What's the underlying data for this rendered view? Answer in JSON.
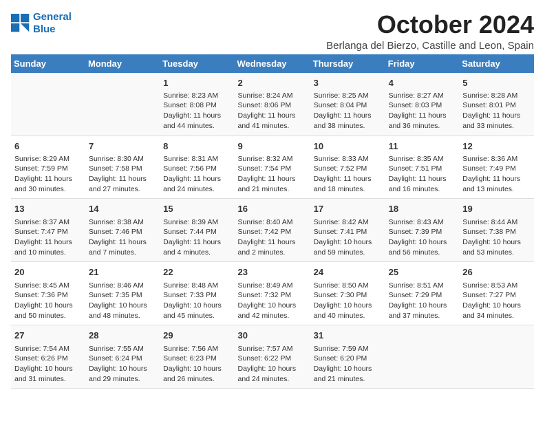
{
  "logo": {
    "line1": "General",
    "line2": "Blue"
  },
  "title": "October 2024",
  "location": "Berlanga del Bierzo, Castille and Leon, Spain",
  "weekdays": [
    "Sunday",
    "Monday",
    "Tuesday",
    "Wednesday",
    "Thursday",
    "Friday",
    "Saturday"
  ],
  "weeks": [
    [
      {
        "day": "",
        "info": ""
      },
      {
        "day": "",
        "info": ""
      },
      {
        "day": "1",
        "info": "Sunrise: 8:23 AM\nSunset: 8:08 PM\nDaylight: 11 hours and 44 minutes."
      },
      {
        "day": "2",
        "info": "Sunrise: 8:24 AM\nSunset: 8:06 PM\nDaylight: 11 hours and 41 minutes."
      },
      {
        "day": "3",
        "info": "Sunrise: 8:25 AM\nSunset: 8:04 PM\nDaylight: 11 hours and 38 minutes."
      },
      {
        "day": "4",
        "info": "Sunrise: 8:27 AM\nSunset: 8:03 PM\nDaylight: 11 hours and 36 minutes."
      },
      {
        "day": "5",
        "info": "Sunrise: 8:28 AM\nSunset: 8:01 PM\nDaylight: 11 hours and 33 minutes."
      }
    ],
    [
      {
        "day": "6",
        "info": "Sunrise: 8:29 AM\nSunset: 7:59 PM\nDaylight: 11 hours and 30 minutes."
      },
      {
        "day": "7",
        "info": "Sunrise: 8:30 AM\nSunset: 7:58 PM\nDaylight: 11 hours and 27 minutes."
      },
      {
        "day": "8",
        "info": "Sunrise: 8:31 AM\nSunset: 7:56 PM\nDaylight: 11 hours and 24 minutes."
      },
      {
        "day": "9",
        "info": "Sunrise: 8:32 AM\nSunset: 7:54 PM\nDaylight: 11 hours and 21 minutes."
      },
      {
        "day": "10",
        "info": "Sunrise: 8:33 AM\nSunset: 7:52 PM\nDaylight: 11 hours and 18 minutes."
      },
      {
        "day": "11",
        "info": "Sunrise: 8:35 AM\nSunset: 7:51 PM\nDaylight: 11 hours and 16 minutes."
      },
      {
        "day": "12",
        "info": "Sunrise: 8:36 AM\nSunset: 7:49 PM\nDaylight: 11 hours and 13 minutes."
      }
    ],
    [
      {
        "day": "13",
        "info": "Sunrise: 8:37 AM\nSunset: 7:47 PM\nDaylight: 11 hours and 10 minutes."
      },
      {
        "day": "14",
        "info": "Sunrise: 8:38 AM\nSunset: 7:46 PM\nDaylight: 11 hours and 7 minutes."
      },
      {
        "day": "15",
        "info": "Sunrise: 8:39 AM\nSunset: 7:44 PM\nDaylight: 11 hours and 4 minutes."
      },
      {
        "day": "16",
        "info": "Sunrise: 8:40 AM\nSunset: 7:42 PM\nDaylight: 11 hours and 2 minutes."
      },
      {
        "day": "17",
        "info": "Sunrise: 8:42 AM\nSunset: 7:41 PM\nDaylight: 10 hours and 59 minutes."
      },
      {
        "day": "18",
        "info": "Sunrise: 8:43 AM\nSunset: 7:39 PM\nDaylight: 10 hours and 56 minutes."
      },
      {
        "day": "19",
        "info": "Sunrise: 8:44 AM\nSunset: 7:38 PM\nDaylight: 10 hours and 53 minutes."
      }
    ],
    [
      {
        "day": "20",
        "info": "Sunrise: 8:45 AM\nSunset: 7:36 PM\nDaylight: 10 hours and 50 minutes."
      },
      {
        "day": "21",
        "info": "Sunrise: 8:46 AM\nSunset: 7:35 PM\nDaylight: 10 hours and 48 minutes."
      },
      {
        "day": "22",
        "info": "Sunrise: 8:48 AM\nSunset: 7:33 PM\nDaylight: 10 hours and 45 minutes."
      },
      {
        "day": "23",
        "info": "Sunrise: 8:49 AM\nSunset: 7:32 PM\nDaylight: 10 hours and 42 minutes."
      },
      {
        "day": "24",
        "info": "Sunrise: 8:50 AM\nSunset: 7:30 PM\nDaylight: 10 hours and 40 minutes."
      },
      {
        "day": "25",
        "info": "Sunrise: 8:51 AM\nSunset: 7:29 PM\nDaylight: 10 hours and 37 minutes."
      },
      {
        "day": "26",
        "info": "Sunrise: 8:53 AM\nSunset: 7:27 PM\nDaylight: 10 hours and 34 minutes."
      }
    ],
    [
      {
        "day": "27",
        "info": "Sunrise: 7:54 AM\nSunset: 6:26 PM\nDaylight: 10 hours and 31 minutes."
      },
      {
        "day": "28",
        "info": "Sunrise: 7:55 AM\nSunset: 6:24 PM\nDaylight: 10 hours and 29 minutes."
      },
      {
        "day": "29",
        "info": "Sunrise: 7:56 AM\nSunset: 6:23 PM\nDaylight: 10 hours and 26 minutes."
      },
      {
        "day": "30",
        "info": "Sunrise: 7:57 AM\nSunset: 6:22 PM\nDaylight: 10 hours and 24 minutes."
      },
      {
        "day": "31",
        "info": "Sunrise: 7:59 AM\nSunset: 6:20 PM\nDaylight: 10 hours and 21 minutes."
      },
      {
        "day": "",
        "info": ""
      },
      {
        "day": "",
        "info": ""
      }
    ]
  ]
}
